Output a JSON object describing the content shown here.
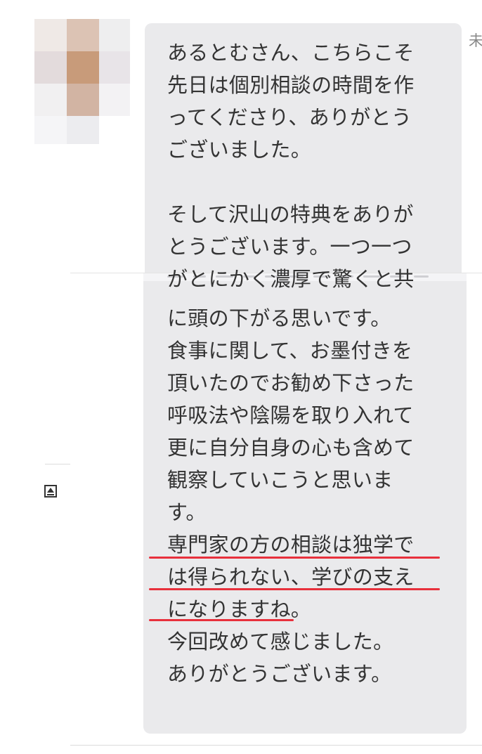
{
  "message": {
    "timestamp_fragment": "未",
    "paragraph_top": "あるとむさん、こちらこそ\n先日は個別相談の時間を作\nってくださり、ありがとう\nございました。\n\nそして沢山の特典をありが\nとうございます。一つ一つ\nがとにかく濃厚で驚くと共",
    "paragraph_bottom": "に頭の下がる思いです。\n食事に関して、お墨付きを\n頂いたのでお勧め下さった\n呼吸法や陰陽を取り入れて\n更に自分自身の心も含めて\n観察していこうと思いま\nす。\n専門家の方の相談は独学で\nは得られない、学びの支え\nになりますね。\n今回改めて感じました。\nありがとうございます。"
  },
  "icons": {
    "avatar": "blurred-avatar",
    "scroll_top": "scroll-to-top-icon"
  },
  "colors": {
    "bubble": "#eaeaec",
    "text": "#333333",
    "underline": "#e8303c"
  }
}
